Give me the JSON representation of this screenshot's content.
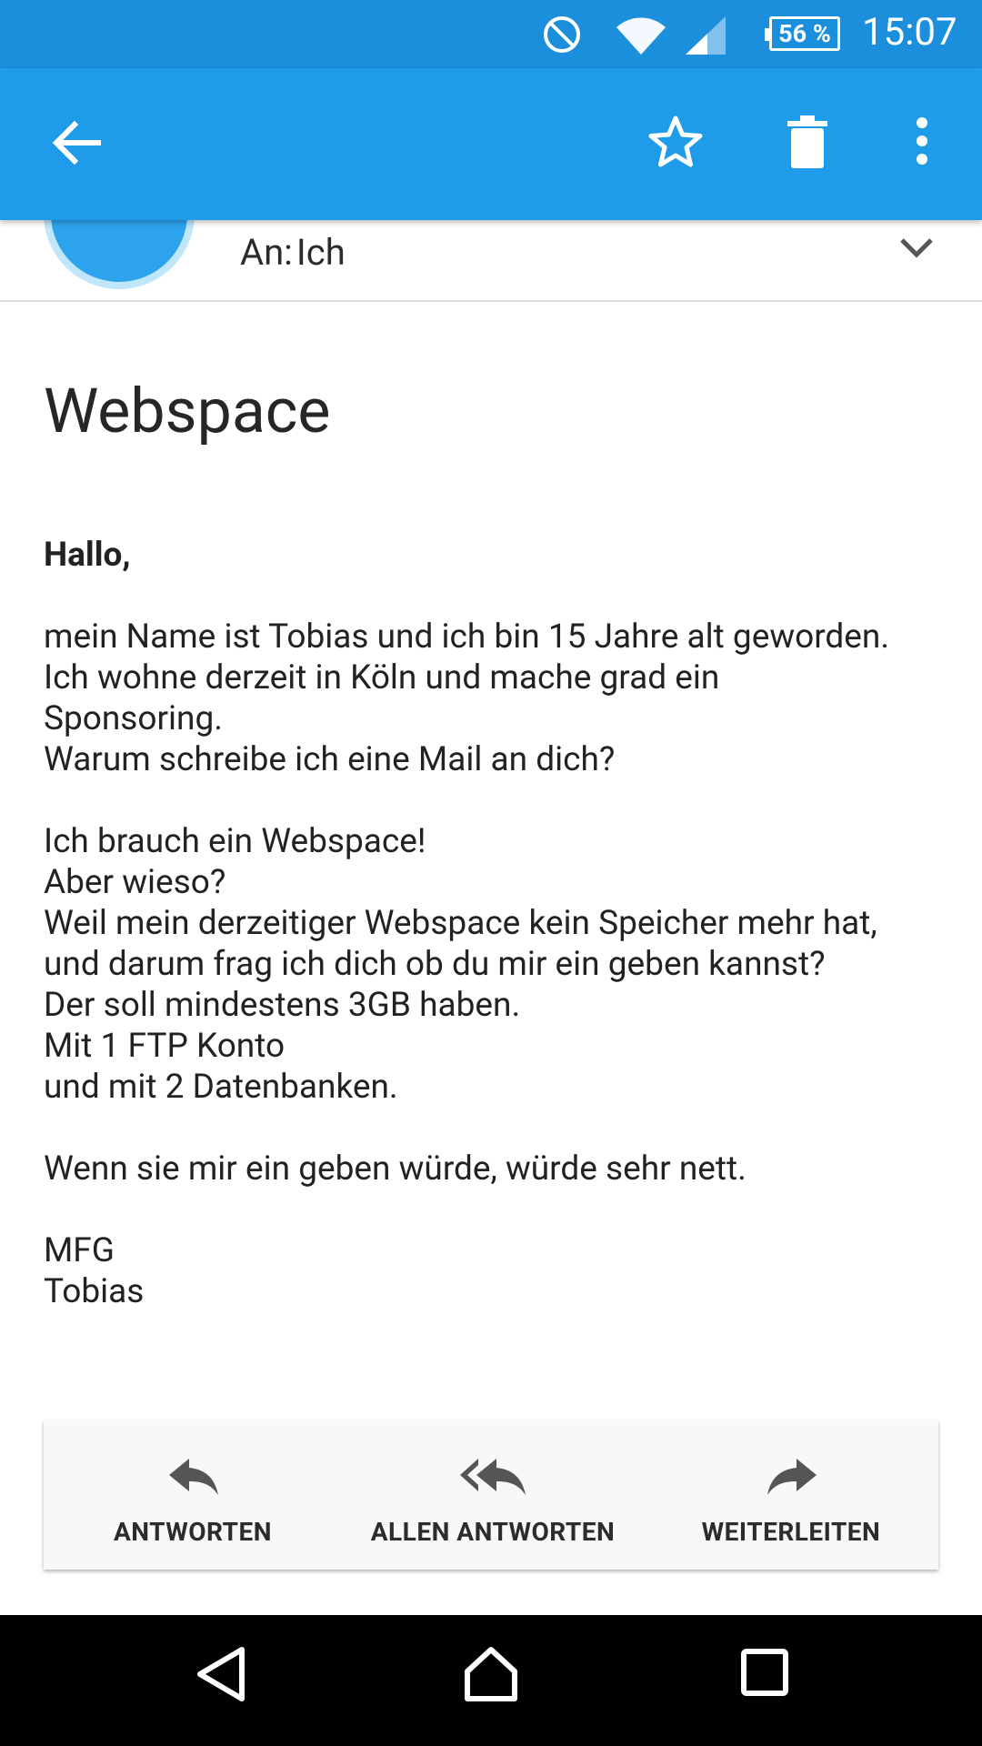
{
  "status_bar": {
    "battery": "56 %",
    "time": "15:07"
  },
  "app_bar": {
    "icons": [
      "back-arrow-icon",
      "star-icon",
      "trash-icon",
      "more-vert-icon"
    ]
  },
  "header": {
    "to_label": "An:",
    "to_value": "Ich"
  },
  "message": {
    "subject": "Webspace",
    "greeting": "Hallo,",
    "lines": [
      "",
      "mein Name ist Tobias und ich bin 15 Jahre alt geworden.",
      "Ich wohne derzeit in Köln und mache grad ein",
      "Sponsoring.",
      "Warum schreibe ich eine Mail an dich?",
      "",
      "Ich brauch ein Webspace!",
      "Aber wieso?",
      "Weil mein derzeitiger Webspace kein Speicher mehr hat,",
      "und darum frag ich dich ob du mir ein geben kannst?",
      "Der soll mindestens 3GB haben.",
      "Mit 1 FTP Konto",
      "und mit 2 Datenbanken.",
      "",
      "Wenn sie mir ein geben würde,  würde sehr nett.",
      "",
      "MFG",
      "Tobias"
    ]
  },
  "actions": {
    "reply": "ANTWORTEN",
    "reply_all": "ALLEN ANTWORTEN",
    "forward": "WEITERLEITEN"
  },
  "colors": {
    "status_bar": "#1c8fdc",
    "app_bar": "#1e9be9",
    "avatar": "#2da3ee"
  }
}
